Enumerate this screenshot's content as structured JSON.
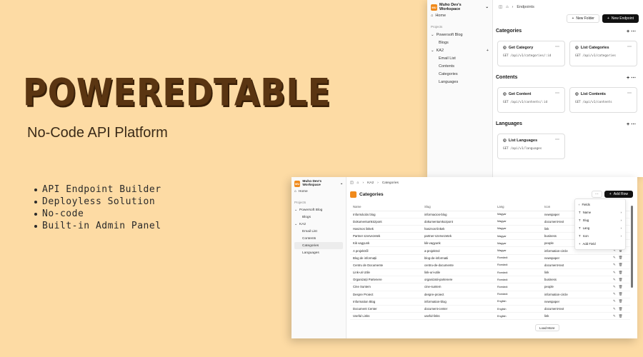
{
  "hero": {
    "title": "POWEREDTABLE",
    "subtitle": "No-Code API Platform",
    "features": [
      "API Endpoint Builder",
      "Deployless Solution",
      "No-code",
      "Built-in Admin Panel"
    ]
  },
  "window1": {
    "workspace": {
      "logo": "MU",
      "name": "Muho Dev's Workspace"
    },
    "home": "Home",
    "projects_label": "Projects",
    "projects": [
      {
        "name": "Powersoft Blog",
        "children": [
          "Blogs"
        ]
      },
      {
        "name": "KA2",
        "children": [
          "Email List",
          "Contents",
          "Categories",
          "Languages"
        ]
      }
    ],
    "breadcrumb": "Endpoints",
    "new_folder": "New Folder",
    "new_endpoint": "New Endpoint",
    "sections": [
      {
        "title": "Categories",
        "cards": [
          {
            "name": "Get Category",
            "path": "GET  /api/v1/categories/:id"
          },
          {
            "name": "List Categories",
            "path": "GET  /api/v1/categories"
          }
        ]
      },
      {
        "title": "Contents",
        "cards": [
          {
            "name": "Get Content",
            "path": "GET  /api/v1/contents/:id"
          },
          {
            "name": "List Contents",
            "path": "GET  /api/v1/contents"
          }
        ]
      },
      {
        "title": "Languages",
        "cards": [
          {
            "name": "List Languages",
            "path": "GET  /api/v1/languages"
          }
        ]
      }
    ]
  },
  "window2": {
    "workspace": {
      "logo": "MU",
      "name": "Muho Dev's Workspace"
    },
    "home": "Home",
    "projects_label": "Projects",
    "breadcrumb": [
      "KA2",
      "Categories"
    ],
    "title": "Categories",
    "add_row": "Add Row",
    "columns": [
      "Name",
      "Slug",
      "Lang",
      "Icon"
    ],
    "rows": [
      [
        "Információs blog",
        "informacios-blog",
        "Magyar",
        "newspaper"
      ],
      [
        "Dokumentumközpont",
        "dokumentumkozpont",
        "Magyar",
        "document-text"
      ],
      [
        "Hasznos linkek",
        "hasznos-linkek",
        "Magyar",
        "link"
      ],
      [
        "Partner szervezetek",
        "partner-szervezetek",
        "Magyar",
        "business"
      ],
      [
        "Kik vagyunk",
        "kik-vagyunk",
        "Magyar",
        "people"
      ],
      [
        "A projektről",
        "a-projektrol",
        "Magyar",
        "information-circle"
      ],
      [
        "Blog de informații",
        "blog-de-informatii",
        "Română",
        "newspaper"
      ],
      [
        "Centru de Documente",
        "centru-de-documente",
        "Română",
        "document-text"
      ],
      [
        "Link-uri Utile",
        "link-uri-utile",
        "Română",
        "link"
      ],
      [
        "Organizații Partenere",
        "organizatii-partenere",
        "Română",
        "business"
      ],
      [
        "Cine Suntem",
        "cine-suntem",
        "Română",
        "people"
      ],
      [
        "Despre Proiect",
        "despre-proiect",
        "Română",
        "information-circle"
      ],
      [
        "Information Blog",
        "information-blog",
        "English",
        "newspaper"
      ],
      [
        "Document Center",
        "document-center",
        "English",
        "document-text"
      ],
      [
        "Useful Links",
        "useful-links",
        "English",
        "link"
      ]
    ],
    "fields_menu": {
      "header": "Fields",
      "items": [
        "Name",
        "Slug",
        "Lang",
        "Icon"
      ],
      "add": "Add Field"
    },
    "load_more": "Load More"
  }
}
